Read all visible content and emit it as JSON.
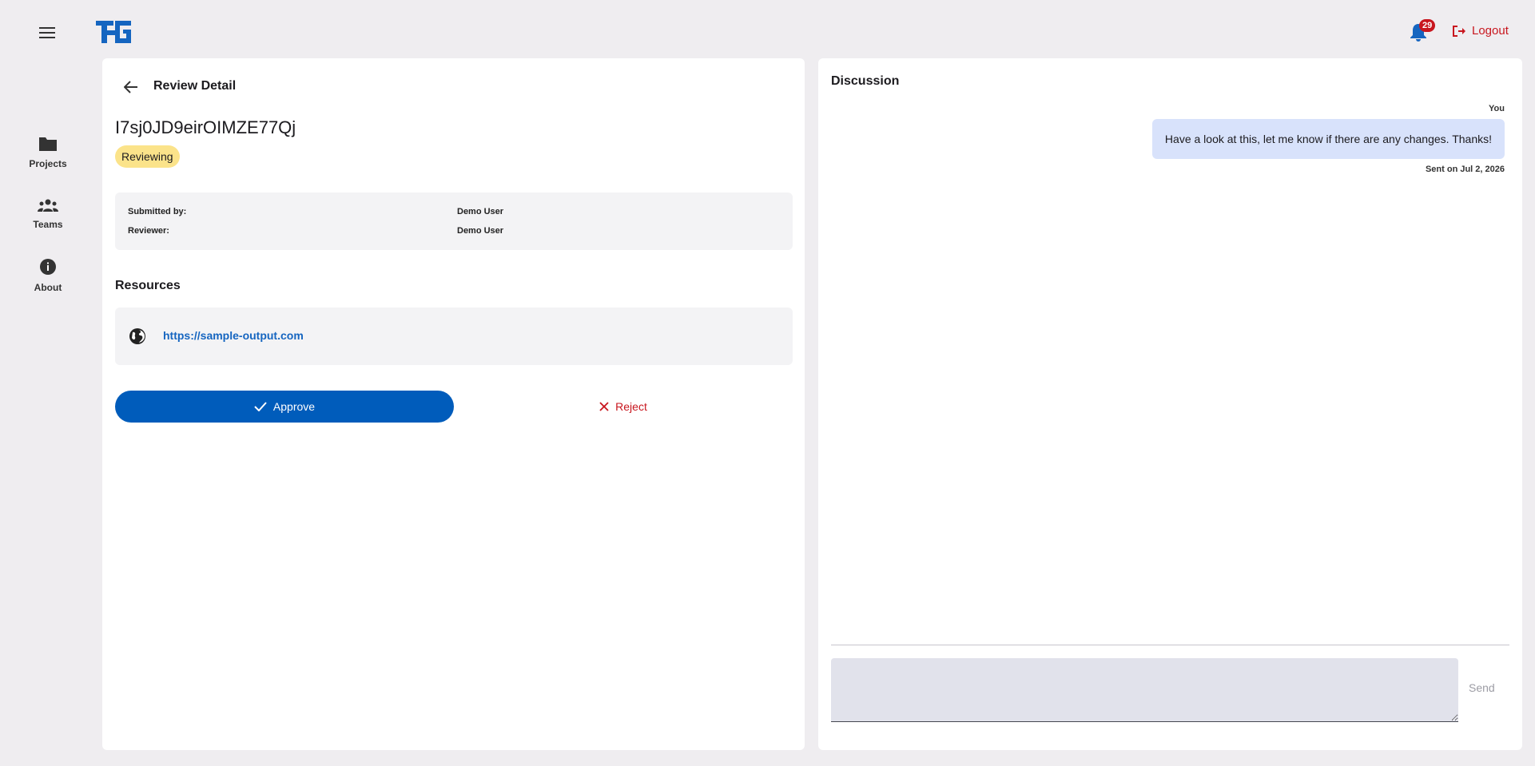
{
  "header": {
    "notification_count": "29",
    "logout_label": "Logout",
    "accent_color": "#005cbb",
    "danger_color": "#c8161e"
  },
  "sidebar": {
    "items": [
      {
        "label": "Projects",
        "icon": "folder-icon"
      },
      {
        "label": "Teams",
        "icon": "groups-icon"
      },
      {
        "label": "About",
        "icon": "info-icon"
      }
    ]
  },
  "review": {
    "page_title": "Review Detail",
    "id": "I7sj0JD9eirOIMZE77Qj",
    "status": "Reviewing",
    "submitted_by_label": "Submitted by:",
    "submitted_by": "Demo User",
    "reviewer_label": "Reviewer:",
    "reviewer": "Demo User",
    "resources_title": "Resources",
    "resource_url": "https://sample-output.com",
    "approve_label": "Approve",
    "reject_label": "Reject"
  },
  "discussion": {
    "title": "Discussion",
    "messages": [
      {
        "author": "You",
        "text": "Have a look at this, let me know if there are any changes. Thanks!",
        "sent": "Sent on Jul 2, 2026"
      }
    ],
    "input_value": "",
    "send_label": "Send"
  }
}
